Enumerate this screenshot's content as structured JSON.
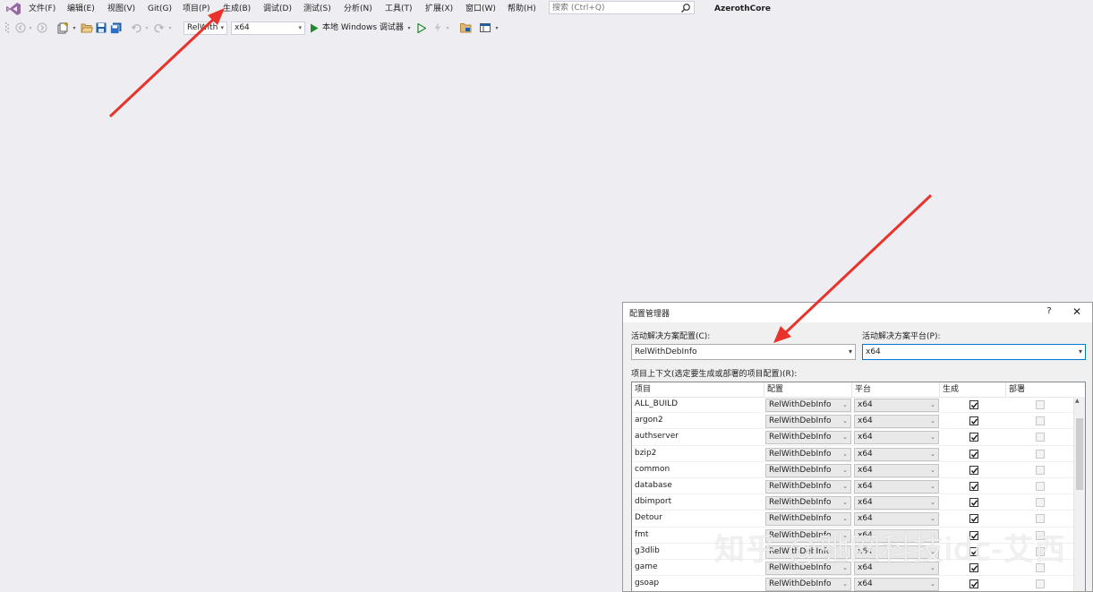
{
  "menubar": {
    "items": [
      "文件(F)",
      "编辑(E)",
      "视图(V)",
      "Git(G)",
      "项目(P)",
      "生成(B)",
      "调试(D)",
      "测试(S)",
      "分析(N)",
      "工具(T)",
      "扩展(X)",
      "窗口(W)",
      "帮助(H)"
    ],
    "search_placeholder": "搜索 (Ctrl+Q)",
    "app_title": "AzerothCore"
  },
  "toolbar": {
    "config_combo": "RelWith",
    "platform_combo": "x64",
    "run_label": "本地 Windows 调试器"
  },
  "dialog": {
    "title": "配置管理器",
    "help": "?",
    "close": "✕",
    "active_config_label": "活动解决方案配置(C):",
    "active_config_value": "RelWithDebInfo",
    "active_platform_label": "活动解决方案平台(P):",
    "active_platform_value": "x64",
    "context_label": "项目上下文(选定要生成或部署的项目配置)(R):",
    "columns": [
      "项目",
      "配置",
      "平台",
      "生成",
      "部署"
    ],
    "rows": [
      {
        "project": "ALL_BUILD",
        "config": "RelWithDebInfo",
        "platform": "x64",
        "build": true,
        "deploy": false
      },
      {
        "project": "argon2",
        "config": "RelWithDebInfo",
        "platform": "x64",
        "build": true,
        "deploy": false
      },
      {
        "project": "authserver",
        "config": "RelWithDebInfo",
        "platform": "x64",
        "build": true,
        "deploy": false
      },
      {
        "project": "bzip2",
        "config": "RelWithDebInfo",
        "platform": "x64",
        "build": true,
        "deploy": false
      },
      {
        "project": "common",
        "config": "RelWithDebInfo",
        "platform": "x64",
        "build": true,
        "deploy": false
      },
      {
        "project": "database",
        "config": "RelWithDebInfo",
        "platform": "x64",
        "build": true,
        "deploy": false
      },
      {
        "project": "dbimport",
        "config": "RelWithDebInfo",
        "platform": "x64",
        "build": true,
        "deploy": false
      },
      {
        "project": "Detour",
        "config": "RelWithDebInfo",
        "platform": "x64",
        "build": true,
        "deploy": false
      },
      {
        "project": "fmt",
        "config": "RelWithDebInfo",
        "platform": "x64",
        "build": true,
        "deploy": false
      },
      {
        "project": "g3dlib",
        "config": "RelWithDebInfo",
        "platform": "x64",
        "build": true,
        "deploy": false
      },
      {
        "project": "game",
        "config": "RelWithDebInfo",
        "platform": "x64",
        "build": true,
        "deploy": false
      },
      {
        "project": "gsoap",
        "config": "RelWithDebInfo",
        "platform": "x64",
        "build": true,
        "deploy": false
      }
    ]
  },
  "watermark": "知乎 @驰网科技idc-艾西",
  "colors": {
    "arrow": "#e8322b",
    "accent": "#0078d7"
  }
}
